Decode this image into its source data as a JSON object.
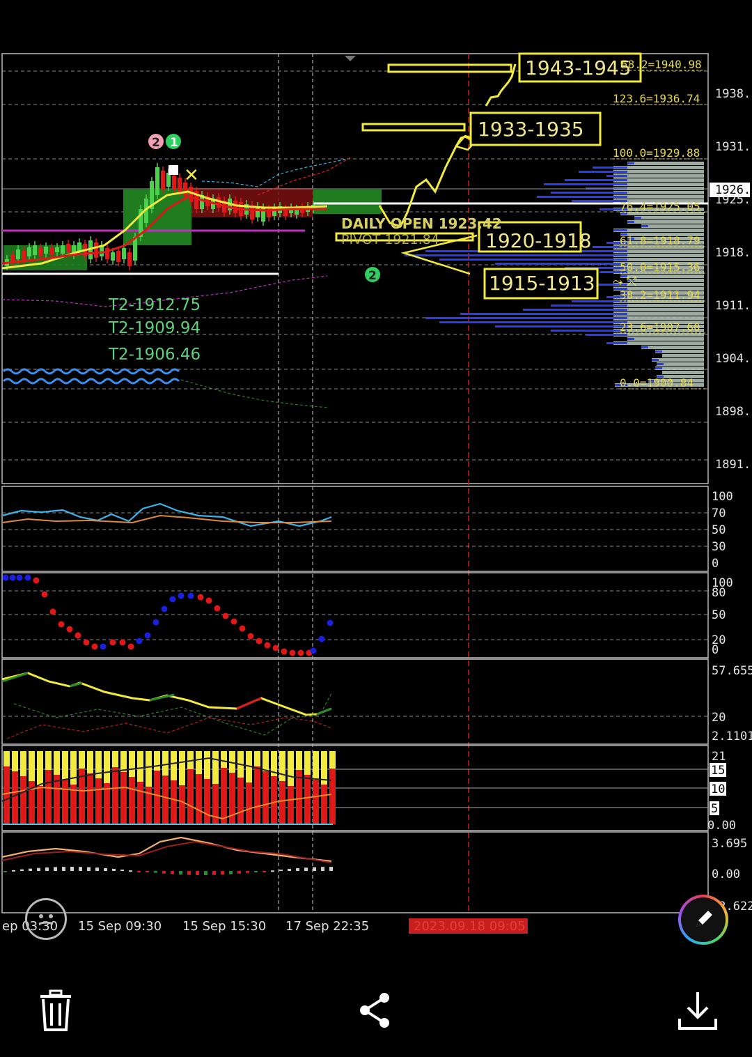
{
  "price_axis": {
    "labels": [
      "1938.",
      "1931.",
      "1926.",
      "1925.",
      "1918.",
      "1911.",
      "1904.",
      "1898.",
      "1891."
    ]
  },
  "fib_levels": [
    {
      "label": "58.2=1940.98"
    },
    {
      "label": "123.6=1936.74"
    },
    {
      "label": "100.0=1929.88"
    },
    {
      "label": "76.4=1925.05"
    },
    {
      "label": "61.8=1918.79"
    },
    {
      "label": "50.0=1915.36"
    },
    {
      "label": "38.2=1911.94"
    },
    {
      "label": "23.6=1907.60"
    },
    {
      "label": "0.0=1900.84"
    }
  ],
  "zones": {
    "z1": "1943-1945",
    "z2": "1933-1935",
    "z3": "1920-1918",
    "z4": "1915-1913"
  },
  "labels": {
    "daily_open": "DAILY OPEN 1923.42",
    "pivot": "PIVOT 1921.84",
    "t2_1": "T2-1912.75",
    "t2_2": "T2-1909.94",
    "t2_3": "T2-1906.46",
    "badge_2": "2",
    "badge_1": "1",
    "badge_2b": "2"
  },
  "rsi_axis": [
    "100",
    "70",
    "50",
    "30",
    "0"
  ],
  "stoch_axis": [
    "100",
    "80",
    "50",
    "20",
    "0"
  ],
  "adx_axis": [
    "57.655",
    "20",
    "2.1101"
  ],
  "vol_axis": [
    "21",
    "15",
    "10",
    "5",
    "0.00"
  ],
  "macd_axis": [
    "3.695",
    "0.00",
    "-2.622"
  ],
  "time_axis": {
    "t0": "ep 03:30",
    "t1": "15 Sep 09:30",
    "t2": "15 Sep 15:30",
    "t3": "17 Sep 22:35",
    "cursor": "2023.09.18 09:05"
  },
  "colors": {
    "yellow": "#f2ea3c",
    "green_fill": "#1f7d1f",
    "red": "#e01818",
    "blue_profile": "#2a3cf0",
    "grey_profile": "#b9c9c0",
    "cursor_red": "#c81e1e"
  }
}
